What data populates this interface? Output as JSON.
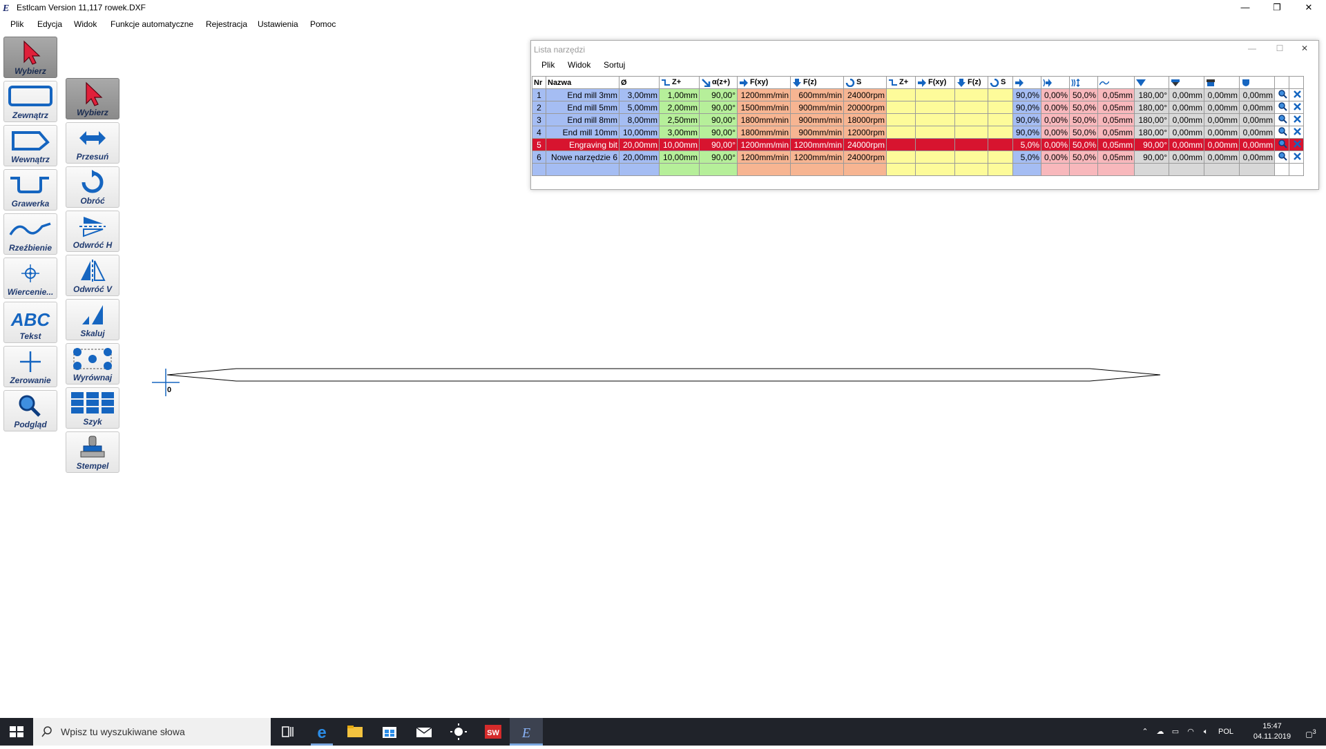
{
  "window": {
    "title": "Estlcam Version 11,117 rowek.DXF",
    "controls": [
      "—",
      "❐",
      "✕"
    ]
  },
  "menu": [
    "Plik",
    "Edycja",
    "Widok",
    "Funkcje automatyczne",
    "Rejestracja",
    "Ustawienia",
    "Pomoc"
  ],
  "toolbar_left": [
    {
      "label": "Wybierz",
      "icon": "cursor-icon",
      "active": true
    },
    {
      "label": "Zewnątrz",
      "icon": "outside-contour-icon"
    },
    {
      "label": "Wewnątrz",
      "icon": "inside-contour-icon"
    },
    {
      "label": "Grawerka",
      "icon": "engraving-icon"
    },
    {
      "label": "Rzeźbienie",
      "icon": "carving-icon"
    },
    {
      "label": "Wiercenie...",
      "icon": "drilling-icon"
    },
    {
      "label": "Tekst",
      "icon": "text-icon",
      "glyph": "ABC"
    },
    {
      "label": "Zerowanie",
      "icon": "zero-crosshair-icon"
    },
    {
      "label": "Podgląd",
      "icon": "preview-magnifier-icon"
    }
  ],
  "toolbar_right": [
    {
      "label": "Wybierz",
      "icon": "cursor-icon",
      "active": true
    },
    {
      "label": "Przesuń",
      "icon": "move-arrows-icon"
    },
    {
      "label": "Obróć",
      "icon": "rotate-icon"
    },
    {
      "label": "Odwróć H",
      "icon": "flip-horizontal-icon"
    },
    {
      "label": "Odwróć V",
      "icon": "flip-vertical-icon"
    },
    {
      "label": "Skaluj",
      "icon": "scale-icon"
    },
    {
      "label": "Wyrównaj",
      "icon": "align-icon"
    },
    {
      "label": "Szyk",
      "icon": "array-grid-icon"
    },
    {
      "label": "Stempel",
      "icon": "stamp-icon"
    }
  ],
  "canvas": {
    "origin_label": "0"
  },
  "tool_list": {
    "title": "Lista narzędzi",
    "menu": [
      "Plik",
      "Widok",
      "Sortuj"
    ],
    "headers": [
      "Nr",
      "Nazwa",
      "Ø",
      "Z+",
      "α(z+)",
      "F(xy)",
      "F(z)",
      "S",
      "Z+",
      "F(xy)",
      "F(z)",
      "S",
      "",
      "",
      "",
      "",
      "",
      "",
      "",
      "",
      "",
      ""
    ],
    "rows": [
      [
        "1",
        "End mill 3mm",
        "3,00mm",
        "1,00mm",
        "90,00°",
        "1200mm/min",
        "600mm/min",
        "24000rpm",
        "",
        "",
        "",
        "",
        "90,0%",
        "0,00%",
        "50,0%",
        "0,05mm",
        "180,00°",
        "0,00mm",
        "0,00mm",
        "0,00mm"
      ],
      [
        "2",
        "End mill 5mm",
        "5,00mm",
        "2,00mm",
        "90,00°",
        "1500mm/min",
        "900mm/min",
        "20000rpm",
        "",
        "",
        "",
        "",
        "90,0%",
        "0,00%",
        "50,0%",
        "0,05mm",
        "180,00°",
        "0,00mm",
        "0,00mm",
        "0,00mm"
      ],
      [
        "3",
        "End mill 8mm",
        "8,00mm",
        "2,50mm",
        "90,00°",
        "1800mm/min",
        "900mm/min",
        "18000rpm",
        "",
        "",
        "",
        "",
        "90,0%",
        "0,00%",
        "50,0%",
        "0,05mm",
        "180,00°",
        "0,00mm",
        "0,00mm",
        "0,00mm"
      ],
      [
        "4",
        "End mill 10mm",
        "10,00mm",
        "3,00mm",
        "90,00°",
        "1800mm/min",
        "900mm/min",
        "12000rpm",
        "",
        "",
        "",
        "",
        "90,0%",
        "0,00%",
        "50,0%",
        "0,05mm",
        "180,00°",
        "0,00mm",
        "0,00mm",
        "0,00mm"
      ],
      [
        "5",
        "Engraving bit",
        "20,00mm",
        "10,00mm",
        "90,00°",
        "1200mm/min",
        "1200mm/min",
        "24000rpm",
        "",
        "",
        "",
        "",
        "5,0%",
        "0,00%",
        "50,0%",
        "0,05mm",
        "90,00°",
        "0,00mm",
        "0,00mm",
        "0,00mm"
      ],
      [
        "6",
        "Nowe narzędzie 6",
        "20,00mm",
        "10,00mm",
        "90,00°",
        "1200mm/min",
        "1200mm/min",
        "24000rpm",
        "",
        "",
        "",
        "",
        "5,0%",
        "0,00%",
        "50,0%",
        "0,05mm",
        "90,00°",
        "0,00mm",
        "0,00mm",
        "0,00mm"
      ],
      [
        "",
        "",
        "",
        "",
        "",
        "",
        "",
        "",
        "",
        "",
        "",
        "",
        "",
        "",
        "",
        "",
        "",
        "",
        "",
        ""
      ]
    ],
    "selected_row": 4
  },
  "taskbar": {
    "search_placeholder": "Wpisz tu wyszukiwane słowa",
    "language": "POL",
    "time": "15:47",
    "date": "04.11.2019",
    "notification_count": "3"
  },
  "colors": {
    "selected_row": "#d7142f",
    "blue_cell": "#a5bdf3",
    "green_cell": "#b6ef9a",
    "orange_cell": "#f7b592",
    "yellow_cell": "#fdfb9a",
    "pink_cell": "#f8b8bc",
    "gray_cell": "#d8d8d8",
    "icon_blue": "#1565c0",
    "cursor_red": "#e0203a"
  }
}
